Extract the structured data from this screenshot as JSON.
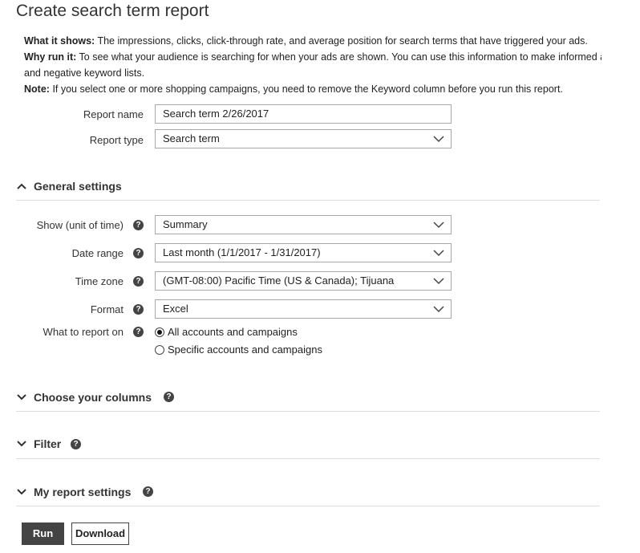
{
  "page": {
    "title": "Create search term report"
  },
  "intro": {
    "what_label": "What it shows:",
    "what_text": "The impressions, clicks, click-through rate, and average position for search terms that have triggered your ads.",
    "why_label": "Why run it:",
    "why_text": "To see what your audience is searching for when your ads are shown. You can use this information to make informed a",
    "why_text_line2": "and negative keyword lists.",
    "note_label": "Note:",
    "note_text": "If you select one or more shopping campaigns, you need to remove the Keyword column before you run this report."
  },
  "report": {
    "name_label": "Report name",
    "name_value": "Search term 2/26/2017",
    "type_label": "Report type",
    "type_value": "Search term"
  },
  "general": {
    "heading": "General settings",
    "show_label": "Show (unit of time)",
    "show_value": "Summary",
    "date_label": "Date range",
    "date_value": "Last month (1/1/2017 - 1/31/2017)",
    "tz_label": "Time zone",
    "tz_value": "(GMT-08:00) Pacific Time (US & Canada); Tijuana",
    "format_label": "Format",
    "format_value": "Excel",
    "scope_label": "What to report on",
    "scope_options": [
      "All accounts and campaigns",
      "Specific accounts and campaigns"
    ],
    "scope_selected": "All accounts and campaigns"
  },
  "sections": {
    "columns": "Choose your columns",
    "filter": "Filter",
    "my_settings": "My report settings"
  },
  "help_glyph": "?",
  "buttons": {
    "run": "Run",
    "download": "Download"
  },
  "icons": [
    "chevron-down-icon",
    "chevron-up-icon",
    "help-icon",
    "radio-button"
  ]
}
